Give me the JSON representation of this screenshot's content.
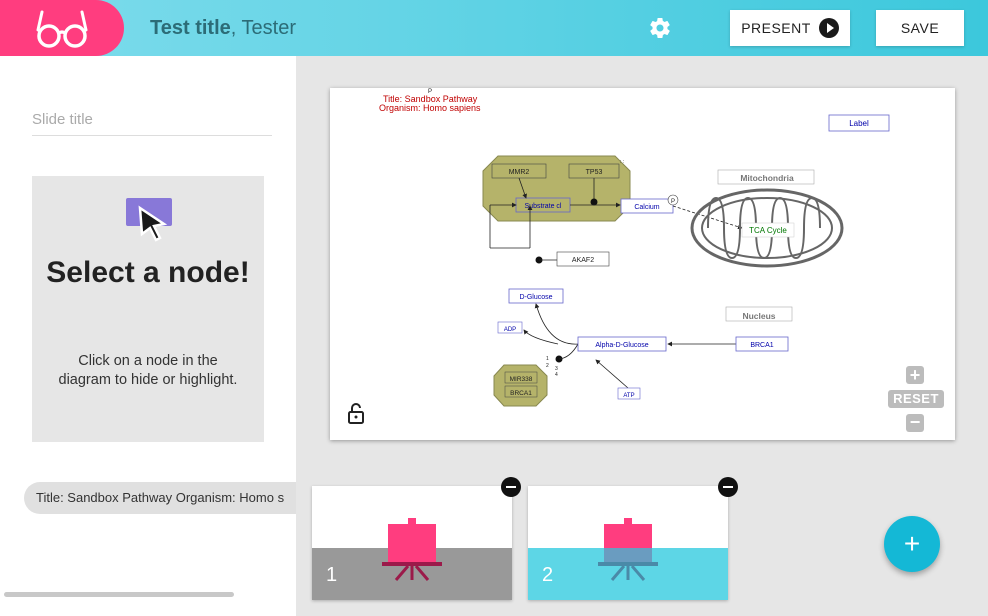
{
  "header": {
    "title_bold": "Test title",
    "title_rest": ", Tester",
    "present_label": "PRESENT",
    "save_label": "SAVE",
    "colors": {
      "brand": "#ff3d7f",
      "accent": "#14b8d6"
    }
  },
  "sidebar": {
    "slide_title_placeholder": "Slide title",
    "hint_title": "Select a node!",
    "hint_text": "Click on a node in the diagram to hide or highlight.",
    "chip_label": "Title: Sandbox Pathway Organism: Homo s"
  },
  "diagram": {
    "info_p": "P",
    "info_title": "Title: Sandbox Pathway",
    "info_organism": "Organism: Homo sapiens",
    "label_node": "Label",
    "mitochondria": "Mitochondria",
    "tca_cycle": "TCA Cycle",
    "nucleus": "Nucleus",
    "mmr2": "MMR2",
    "tp53": "TP53",
    "substrate": "Substrate cl",
    "calcium": "Calcium",
    "calcium_p": "P",
    "akaf2": "AKAF2",
    "d_glucose": "D-Glucose",
    "adp": "ADP",
    "alpha_d_glucose": "Alpha-D-Glucose",
    "brca1_node": "BRCA1",
    "atp": "ATP",
    "mir338": "MIR338",
    "brca1_group": "BRCA1",
    "anchor_labels": [
      "1",
      "2",
      "3",
      "4"
    ]
  },
  "zoom": {
    "reset_label": "RESET",
    "plus": "+",
    "minus": "−"
  },
  "slides": [
    {
      "number": "1",
      "bottom_color": "#999999"
    },
    {
      "number": "2",
      "bottom_color": "#5dd6e6"
    }
  ],
  "fab_label": "+"
}
